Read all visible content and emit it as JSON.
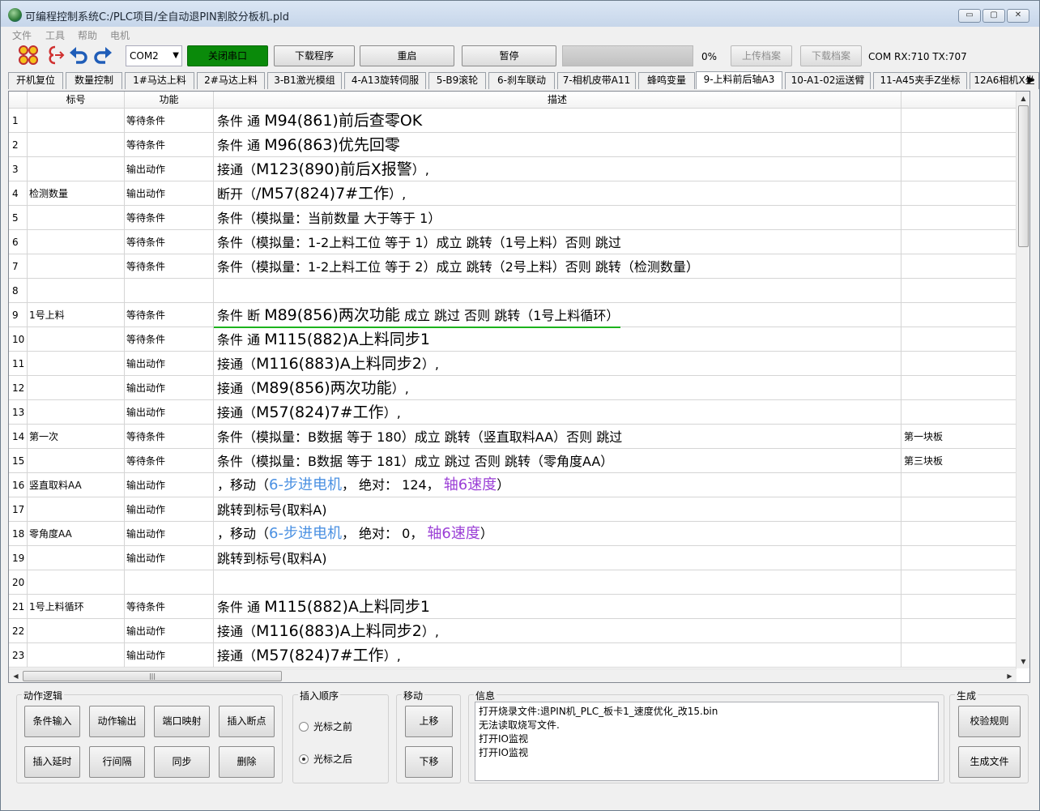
{
  "window": {
    "title": "可编程控制系统C:/PLC项目/全自动退PIN割胶分板机.pld",
    "controls": [
      "▭",
      "▢",
      "✕"
    ]
  },
  "menu": [
    "文件",
    "工具",
    "帮助",
    "电机"
  ],
  "toolbar": {
    "port": "COM2",
    "close_port": "关闭串口",
    "download_program": "下载程序",
    "restart": "重启",
    "pause": "暂停",
    "progress_percent": "0%",
    "progress_value": 0,
    "upload_archive": "上传档案",
    "download_archive": "下载档案",
    "com_status": "COM RX:710 TX:707"
  },
  "tabs": [
    "开机复位",
    "数量控制",
    "1#马达上料",
    "2#马达上料",
    "3-B1激光模组",
    "4-A13旋转伺服",
    "5-B9滚轮",
    "6-刹车联动",
    "7-相机皮带A11",
    "蜂鸣变量",
    "9-上料前后轴A3",
    "10-A1-02运送臂",
    "11-A45夹手Z坐标",
    "12A6相机X坐"
  ],
  "active_tab_index": 10,
  "grid": {
    "headers": [
      "标号",
      "功能",
      "描述"
    ],
    "rows": [
      {
        "n": "1",
        "label": "",
        "func": "等待条件",
        "d1": "条件 通 ",
        "d2": "M94(861)前后查零OK",
        "d3": "",
        "note": ""
      },
      {
        "n": "2",
        "label": "",
        "func": "等待条件",
        "d1": "条件 通 ",
        "d2": "M96(863)优先回零",
        "d3": "",
        "note": ""
      },
      {
        "n": "3",
        "label": "",
        "func": "输出动作",
        "d1": "接通（",
        "d2": "M123(890)前后X报警",
        "d3": "）,",
        "note": ""
      },
      {
        "n": "4",
        "label": "检测数量",
        "func": "输出动作",
        "d1": "断开（",
        "d2": "/M57(824)7#工作",
        "d3": "）,",
        "note": ""
      },
      {
        "n": "5",
        "label": "",
        "func": "等待条件",
        "d1": "条件（模拟量：当前数量 大于等于 1）",
        "d2": "",
        "d3": "",
        "note": ""
      },
      {
        "n": "6",
        "label": "",
        "func": "等待条件",
        "d1": "条件（模拟量：1-2上料工位 等于 1）成立 跳转（1号上料）否则 跳过",
        "d2": "",
        "d3": "",
        "note": ""
      },
      {
        "n": "7",
        "label": "",
        "func": "等待条件",
        "d1": "条件（模拟量：1-2上料工位 等于 2）成立 跳转（2号上料）否则 跳转（检测数量）",
        "d2": "",
        "d3": "",
        "note": ""
      },
      {
        "n": "8",
        "label": "",
        "func": "",
        "d1": "",
        "d2": "",
        "d3": "",
        "note": ""
      },
      {
        "n": "9",
        "label": "1号上料",
        "func": "等待条件",
        "d1": "条件 断 ",
        "d2": "M89(856)两次功能",
        "d3": " 成立 跳过 否则 跳转（1号上料循环）",
        "note": ""
      },
      {
        "n": "10",
        "label": "",
        "func": "等待条件",
        "d1": "条件 通 ",
        "d2": "M115(882)A上料同步1",
        "d3": "",
        "note": ""
      },
      {
        "n": "11",
        "label": "",
        "func": "输出动作",
        "d1": "接通（",
        "d2": "M116(883)A上料同步2",
        "d3": "）,",
        "note": ""
      },
      {
        "n": "12",
        "label": "",
        "func": "输出动作",
        "d1": "接通（",
        "d2": "M89(856)两次功能",
        "d3": "）,",
        "note": ""
      },
      {
        "n": "13",
        "label": "",
        "func": "输出动作",
        "d1": "接通（",
        "d2": "M57(824)7#工作",
        "d3": "）,",
        "note": ""
      },
      {
        "n": "14",
        "label": "第一次",
        "func": "等待条件",
        "d1": "条件（模拟量：B数据 等于 180）成立 跳转（竖直取料AA）否则 跳过",
        "d2": "",
        "d3": "",
        "note": "第一块板"
      },
      {
        "n": "15",
        "label": "",
        "func": "等待条件",
        "d1": "条件（模拟量：B数据 等于 181）成立 跳过 否则 跳转（零角度AA）",
        "d2": "",
        "d3": "",
        "note": "第三块板"
      },
      {
        "n": "16",
        "label": "竖直取料AA",
        "func": "输出动作",
        "m1": "，移动（",
        "motor": "6-步进电机",
        "m2": "， 绝对： 124， ",
        "speed": "轴6速度",
        "m3": "）",
        "note": ""
      },
      {
        "n": "17",
        "label": "",
        "func": "输出动作",
        "d1": "跳转到标号(取料A)",
        "d2": "",
        "d3": "",
        "note": ""
      },
      {
        "n": "18",
        "label": "零角度AA",
        "func": "输出动作",
        "m1": "，移动（",
        "motor": "6-步进电机",
        "m2": "， 绝对： 0， ",
        "speed": "轴6速度",
        "m3": "）",
        "note": ""
      },
      {
        "n": "19",
        "label": "",
        "func": "输出动作",
        "d1": "跳转到标号(取料A)",
        "d2": "",
        "d3": "",
        "note": ""
      },
      {
        "n": "20",
        "label": "",
        "func": "",
        "d1": "",
        "d2": "",
        "d3": "",
        "note": ""
      },
      {
        "n": "21",
        "label": "1号上料循环",
        "func": "等待条件",
        "d1": "条件 通 ",
        "d2": "M115(882)A上料同步1",
        "d3": "",
        "note": ""
      },
      {
        "n": "22",
        "label": "",
        "func": "输出动作",
        "d1": "接通（",
        "d2": "M116(883)A上料同步2",
        "d3": "）,",
        "note": ""
      },
      {
        "n": "23",
        "label": "",
        "func": "输出动作",
        "d1": "接通（",
        "d2": "M57(824)7#工作",
        "d3": "）,",
        "note": ""
      }
    ]
  },
  "panels": {
    "action_logic": {
      "title": "动作逻辑",
      "buttons": [
        "条件输入",
        "动作输出",
        "端口映射",
        "插入断点",
        "插入延时",
        "行间隔",
        "同步",
        "删除"
      ]
    },
    "insert_order": {
      "title": "插入顺序",
      "before": "光标之前",
      "after": "光标之后"
    },
    "move": {
      "title": "移动",
      "up": "上移",
      "down": "下移"
    },
    "info": {
      "title": "信息",
      "lines": [
        "打开烧录文件:退PIN机_PLC_板卡1_速度优化_改15.bin",
        "无法读取烧写文件.",
        "打开IO监视",
        "打开IO监视"
      ]
    },
    "generate": {
      "title": "生成",
      "verify": "校验规则",
      "generate_file": "生成文件"
    }
  }
}
